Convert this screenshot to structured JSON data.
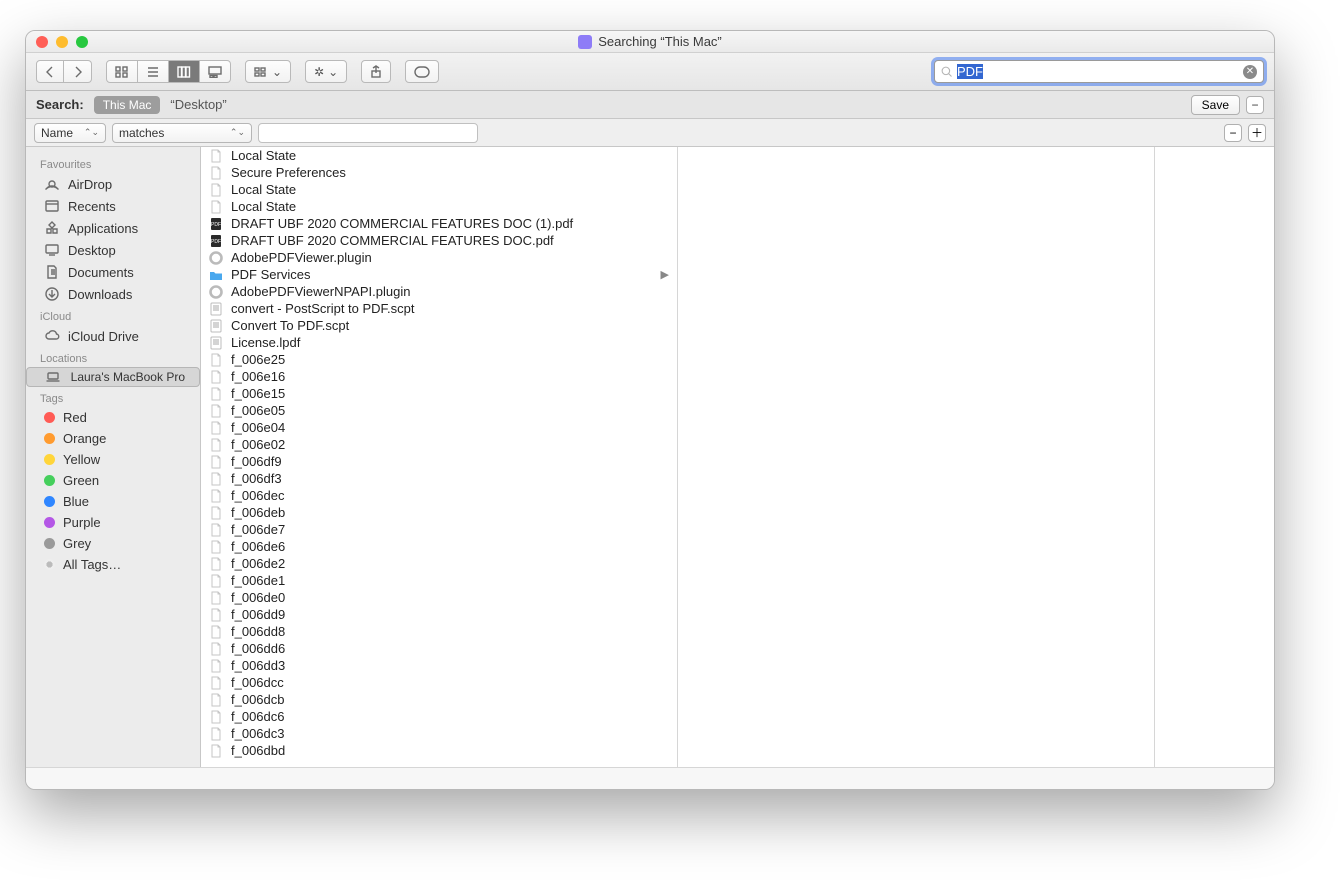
{
  "title": "Searching “This Mac”",
  "search": {
    "value": "PDF",
    "placeholder": "Search"
  },
  "scope": {
    "label": "Search:",
    "this_mac": "This Mac",
    "desktop": "“Desktop”",
    "save": "Save"
  },
  "criteria": {
    "attr": "Name",
    "op": "matches"
  },
  "sidebar": {
    "favourites_label": "Favourites",
    "favourites": [
      {
        "label": "AirDrop",
        "icon": "airdrop"
      },
      {
        "label": "Recents",
        "icon": "clock"
      },
      {
        "label": "Applications",
        "icon": "apps"
      },
      {
        "label": "Desktop",
        "icon": "desktop"
      },
      {
        "label": "Documents",
        "icon": "doc"
      },
      {
        "label": "Downloads",
        "icon": "download"
      }
    ],
    "icloud_label": "iCloud",
    "icloud": [
      {
        "label": "iCloud Drive",
        "icon": "cloud"
      }
    ],
    "locations_label": "Locations",
    "locations": [
      {
        "label": "Laura's MacBook Pro",
        "icon": "laptop",
        "selected": true
      }
    ],
    "tags_label": "Tags",
    "tags": [
      {
        "label": "Red",
        "color": "#ff5b55"
      },
      {
        "label": "Orange",
        "color": "#ff9b2f"
      },
      {
        "label": "Yellow",
        "color": "#ffd53a"
      },
      {
        "label": "Green",
        "color": "#45cf5c"
      },
      {
        "label": "Blue",
        "color": "#2f86ff"
      },
      {
        "label": "Purple",
        "color": "#b457e6"
      },
      {
        "label": "Grey",
        "color": "#9a9a9a"
      }
    ],
    "all_tags": "All Tags…"
  },
  "results": [
    {
      "name": "Local State",
      "kind": "file"
    },
    {
      "name": "Secure Preferences",
      "kind": "file"
    },
    {
      "name": "Local State",
      "kind": "file"
    },
    {
      "name": "Local State",
      "kind": "file"
    },
    {
      "name": "DRAFT UBF 2020 COMMERCIAL FEATURES DOC (1).pdf",
      "kind": "pdf"
    },
    {
      "name": "DRAFT UBF 2020 COMMERCIAL FEATURES DOC.pdf",
      "kind": "pdf"
    },
    {
      "name": "AdobePDFViewer.plugin",
      "kind": "plugin"
    },
    {
      "name": "PDF Services",
      "kind": "folder"
    },
    {
      "name": "AdobePDFViewerNPAPI.plugin",
      "kind": "plugin"
    },
    {
      "name": "convert - PostScript to PDF.scpt",
      "kind": "script"
    },
    {
      "name": "Convert To PDF.scpt",
      "kind": "script"
    },
    {
      "name": "License.lpdf",
      "kind": "text"
    },
    {
      "name": "f_006e25",
      "kind": "file"
    },
    {
      "name": "f_006e16",
      "kind": "file"
    },
    {
      "name": "f_006e15",
      "kind": "file"
    },
    {
      "name": "f_006e05",
      "kind": "file"
    },
    {
      "name": "f_006e04",
      "kind": "file"
    },
    {
      "name": "f_006e02",
      "kind": "file"
    },
    {
      "name": "f_006df9",
      "kind": "file"
    },
    {
      "name": "f_006df3",
      "kind": "file"
    },
    {
      "name": "f_006dec",
      "kind": "file"
    },
    {
      "name": "f_006deb",
      "kind": "file"
    },
    {
      "name": "f_006de7",
      "kind": "file"
    },
    {
      "name": "f_006de6",
      "kind": "file"
    },
    {
      "name": "f_006de2",
      "kind": "file"
    },
    {
      "name": "f_006de1",
      "kind": "file"
    },
    {
      "name": "f_006de0",
      "kind": "file"
    },
    {
      "name": "f_006dd9",
      "kind": "file"
    },
    {
      "name": "f_006dd8",
      "kind": "file"
    },
    {
      "name": "f_006dd6",
      "kind": "file"
    },
    {
      "name": "f_006dd3",
      "kind": "file"
    },
    {
      "name": "f_006dcc",
      "kind": "file"
    },
    {
      "name": "f_006dcb",
      "kind": "file"
    },
    {
      "name": "f_006dc6",
      "kind": "file"
    },
    {
      "name": "f_006dc3",
      "kind": "file"
    },
    {
      "name": "f_006dbd",
      "kind": "file"
    }
  ]
}
